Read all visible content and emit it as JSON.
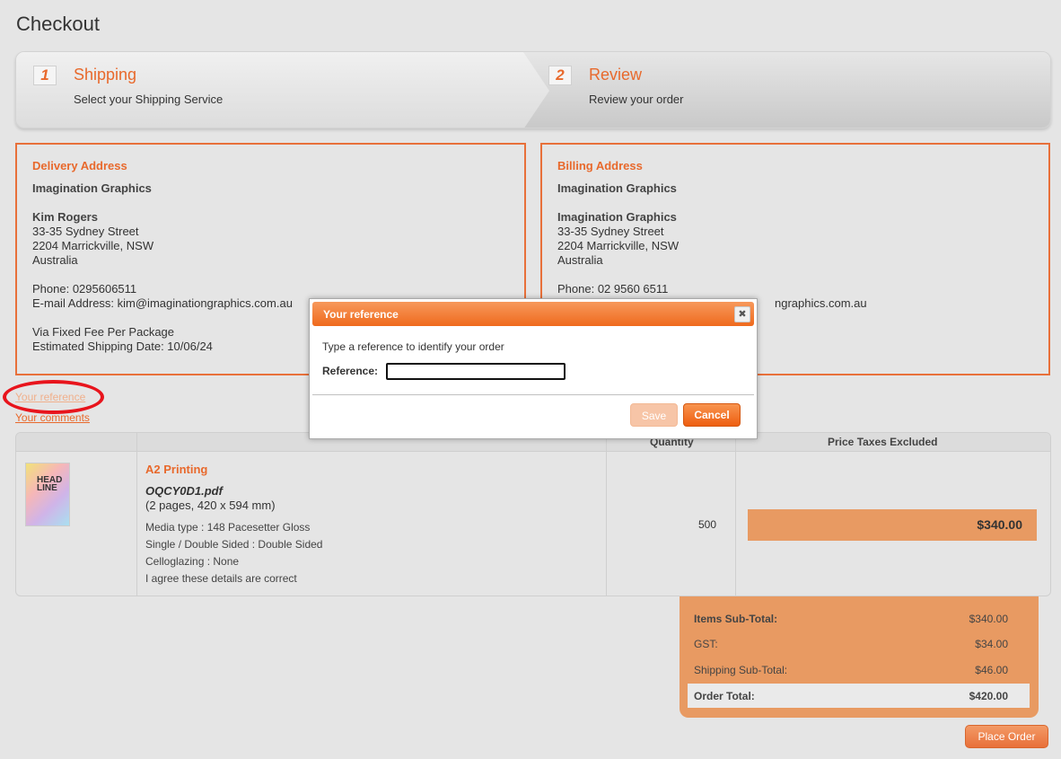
{
  "page": {
    "title": "Checkout"
  },
  "steps": [
    {
      "number": "1",
      "title": "Shipping",
      "subtitle": "Select your Shipping Service"
    },
    {
      "number": "2",
      "title": "Review",
      "subtitle": "Review your order"
    }
  ],
  "delivery": {
    "heading": "Delivery Address",
    "company": "Imagination Graphics",
    "name": "Kim Rogers",
    "street": "33-35 Sydney Street",
    "city": "2204 Marrickville, NSW",
    "country": "Australia",
    "phone": "Phone: 0295606511",
    "email": "E-mail Address: kim@imaginationgraphics.com.au",
    "via": "Via Fixed Fee Per Package",
    "ship_date": "Estimated Shipping Date: 10/06/24"
  },
  "billing": {
    "heading": "Billing Address",
    "company": "Imagination Graphics",
    "name": "Imagination Graphics",
    "street": "33-35 Sydney Street",
    "city": "2204 Marrickville, NSW",
    "country": "Australia",
    "phone": "Phone: 02 9560 6511",
    "email_partial": "ngraphics.com.au"
  },
  "links": {
    "reference": "Your reference",
    "comments": "Your comments"
  },
  "table": {
    "headers": {
      "quantity": "Quantity",
      "price": "Price Taxes Excluded"
    },
    "item": {
      "thumb_text": "HEAD\nLINE",
      "title": "A2 Printing",
      "file": "OQCY0D1.pdf",
      "pages": "(2 pages, 420 x 594 mm)",
      "details": [
        "Media type : 148 Pacesetter Gloss",
        "Single / Double Sided : Double Sided",
        "Celloglazing : None",
        "I agree these details are correct"
      ],
      "quantity": "500",
      "price": "$340.00"
    }
  },
  "totals": {
    "items_label": "Items Sub-Total:",
    "items_value": "$340.00",
    "gst_label": "GST:",
    "gst_value": "$34.00",
    "shipping_label": "Shipping Sub-Total:",
    "shipping_value": "$46.00",
    "total_label": "Order Total:",
    "total_value": "$420.00"
  },
  "place_order_label": "Place Order",
  "modal": {
    "title": "Your reference",
    "close_glyph": "✖",
    "instruction": "Type a reference to identify your order",
    "field_label": "Reference:",
    "field_value": "",
    "save_label": "Save",
    "cancel_label": "Cancel"
  },
  "colors": {
    "accent": "#e8692c",
    "highlight": "#e89a62",
    "annotation": "#e8141c"
  }
}
